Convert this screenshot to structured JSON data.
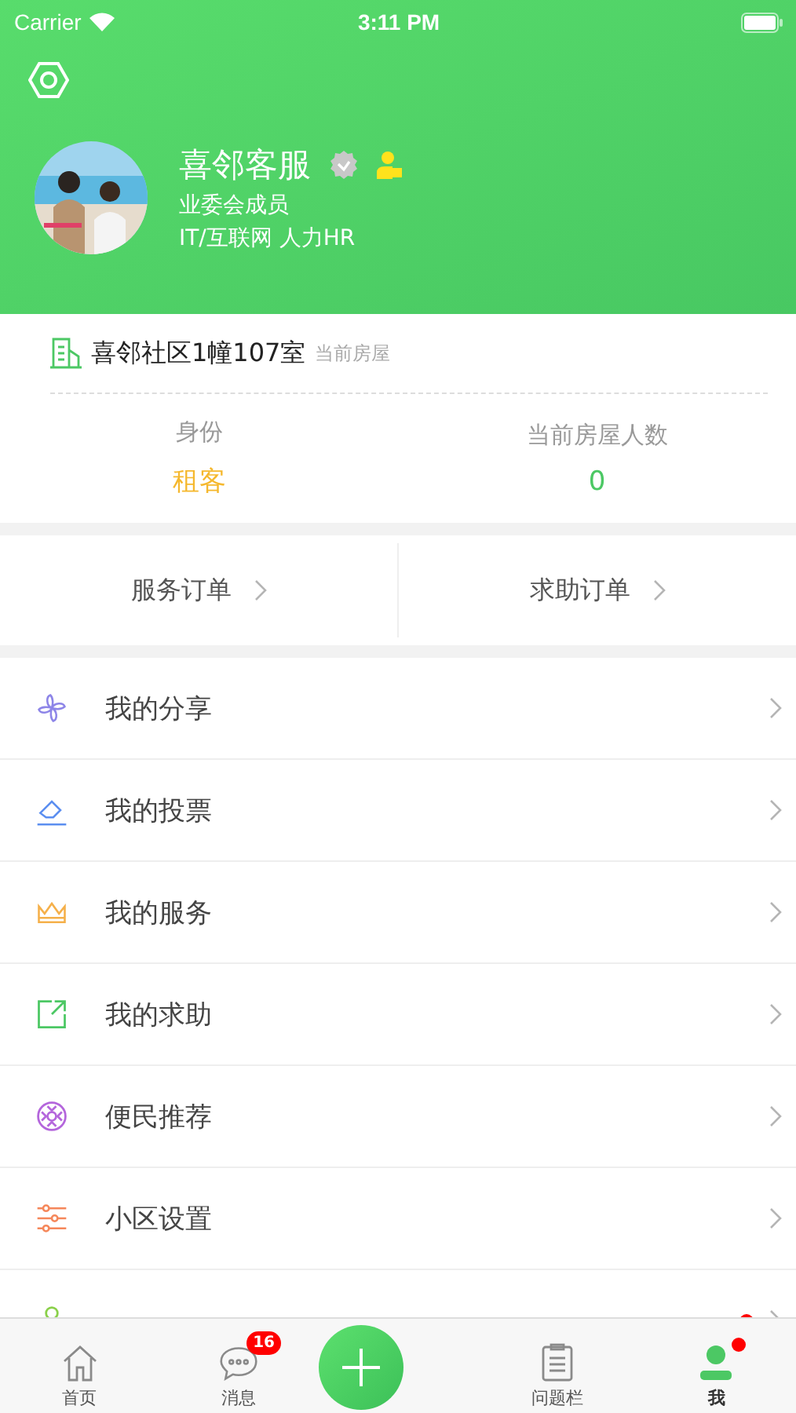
{
  "status_bar": {
    "carrier": "Carrier",
    "time": "3:11 PM"
  },
  "profile": {
    "name": "喜邻客服",
    "verified": true,
    "role": "业委会成员",
    "tags": "IT/互联网 人力HR"
  },
  "house": {
    "address": "喜邻社区1幢107室",
    "note": "当前房屋"
  },
  "stats": [
    {
      "label": "身份",
      "value": "租客",
      "color": "#f5b82e"
    },
    {
      "label": "当前房屋人数",
      "value": "0",
      "color": "#4cc864"
    }
  ],
  "orders": [
    "服务订单",
    "求助订单"
  ],
  "menu": [
    {
      "kind": "pinwheel",
      "label": "我的分享",
      "dot": false
    },
    {
      "kind": "tag",
      "label": "我的投票",
      "dot": false
    },
    {
      "kind": "crown",
      "label": "我的服务",
      "dot": false
    },
    {
      "kind": "share",
      "label": "我的求助",
      "dot": false
    },
    {
      "kind": "flower",
      "label": "便民推荐",
      "dot": false
    },
    {
      "kind": "sliders",
      "label": "小区设置",
      "dot": false
    },
    {
      "kind": "pin",
      "dot": true
    }
  ],
  "tabbar": [
    {
      "kind": "home",
      "label": "首页",
      "selected": false,
      "dot": false
    },
    {
      "kind": "chat",
      "label": "消息",
      "selected": false,
      "badge": "16",
      "dot": false
    },
    {
      "kind": "plus",
      "selected": false
    },
    {
      "kind": "clipboard",
      "label": "问题栏",
      "selected": false,
      "dot": false
    },
    {
      "kind": "person",
      "label": "我",
      "selected": true,
      "dot": true
    }
  ]
}
